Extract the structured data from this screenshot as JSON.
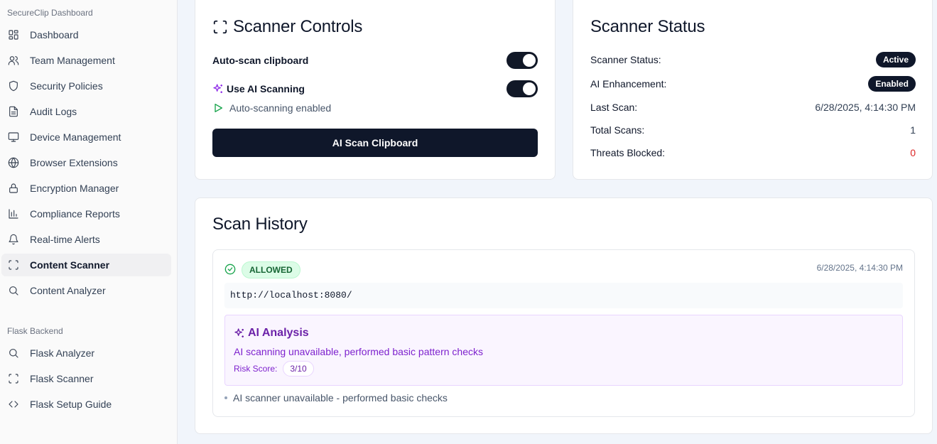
{
  "sidebar": {
    "group_title": "SecureClip Dashboard",
    "items": [
      {
        "label": "Dashboard",
        "icon": "dashboard-icon"
      },
      {
        "label": "Team Management",
        "icon": "users-icon"
      },
      {
        "label": "Security Policies",
        "icon": "shield-icon"
      },
      {
        "label": "Audit Logs",
        "icon": "document-icon"
      },
      {
        "label": "Device Management",
        "icon": "monitor-icon"
      },
      {
        "label": "Browser Extensions",
        "icon": "globe-icon"
      },
      {
        "label": "Encryption Manager",
        "icon": "lock-icon"
      },
      {
        "label": "Compliance Reports",
        "icon": "bar-chart-icon"
      },
      {
        "label": "Real-time Alerts",
        "icon": "bell-icon"
      },
      {
        "label": "Content Scanner",
        "icon": "scan-icon",
        "active": true
      },
      {
        "label": "Content Analyzer",
        "icon": "search-icon"
      }
    ],
    "backend_title": "Flask Backend",
    "backend_items": [
      {
        "label": "Flask Analyzer",
        "icon": "search-icon"
      },
      {
        "label": "Flask Scanner",
        "icon": "scan-icon"
      },
      {
        "label": "Flask Setup Guide",
        "icon": "code-icon"
      }
    ]
  },
  "controls": {
    "title": "Scanner Controls",
    "auto_scan_label": "Auto-scan clipboard",
    "auto_scan_on": true,
    "ai_scan_label": "Use AI Scanning",
    "ai_scan_on": true,
    "status_text": "Auto-scanning enabled",
    "button_label": "AI Scan Clipboard"
  },
  "status": {
    "title": "Scanner Status",
    "rows": [
      {
        "label": "Scanner Status:",
        "value": "Active"
      },
      {
        "label": "AI Enhancement:",
        "value": "Enabled"
      },
      {
        "label": "Last Scan:",
        "value": "6/28/2025, 4:14:30 PM"
      },
      {
        "label": "Total Scans:",
        "value": "1"
      },
      {
        "label": "Threats Blocked:",
        "value": "0"
      }
    ]
  },
  "history": {
    "title": "Scan History",
    "entries": [
      {
        "badge": "ALLOWED",
        "timestamp": "6/28/2025, 4:14:30 PM",
        "content": "http://localhost:8080/",
        "ai_title": "AI Analysis",
        "ai_description": "AI scanning unavailable, performed basic pattern checks",
        "risk_label": "Risk Score:",
        "risk_value": "3/10",
        "notes": [
          "AI scanner unavailable - performed basic checks"
        ]
      }
    ]
  },
  "colors": {
    "primary": "#0f172a",
    "allowed_bg": "#dcfce7",
    "allowed_text": "#166534",
    "ai_bg": "#faf5ff",
    "ai_text": "#7e22ce",
    "threat": "#dc2626"
  }
}
